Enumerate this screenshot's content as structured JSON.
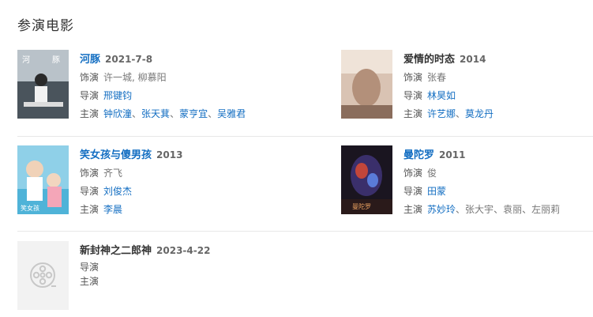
{
  "section": {
    "title": "参演电影"
  },
  "movies": [
    {
      "title": "河豚",
      "date": "2021-7-8",
      "role_label": "饰演",
      "role": "许一城, 柳慕阳",
      "director_label": "导演",
      "directors": [
        "邢键钧"
      ],
      "cast_label": "主演",
      "cast": [
        "钟欣潼",
        "张天萁",
        "蒙亨宜",
        "吴雅君"
      ]
    },
    {
      "title": "爱情的时态",
      "date": "2014",
      "role_label": "饰演",
      "role": "张春",
      "director_label": "导演",
      "directors": [
        "林昊如"
      ],
      "cast_label": "主演",
      "cast": [
        "许艺娜",
        "莫龙丹"
      ]
    },
    {
      "title": "笑女孩与傻男孩",
      "date": "2013",
      "role_label": "饰演",
      "role": "齐飞",
      "director_label": "导演",
      "directors": [
        "刘俊杰"
      ],
      "cast_label": "主演",
      "cast": [
        "李晨"
      ]
    },
    {
      "title": "曼陀罗",
      "date": "2011",
      "role_label": "饰演",
      "role": "俊",
      "director_label": "导演",
      "directors": [
        "田蒙"
      ],
      "cast_label": "主演",
      "cast": [
        "苏妙玲",
        "张大宇",
        "袁丽",
        "左丽莉"
      ]
    },
    {
      "title": "新封神之二郎神",
      "date": "2023-4-22",
      "director_label": "导演",
      "cast_label": "主演"
    }
  ],
  "colors": {
    "link": "#136ec2",
    "divider": "#e8e8e8"
  },
  "icons": {
    "placeholder": "film-reel-icon"
  }
}
